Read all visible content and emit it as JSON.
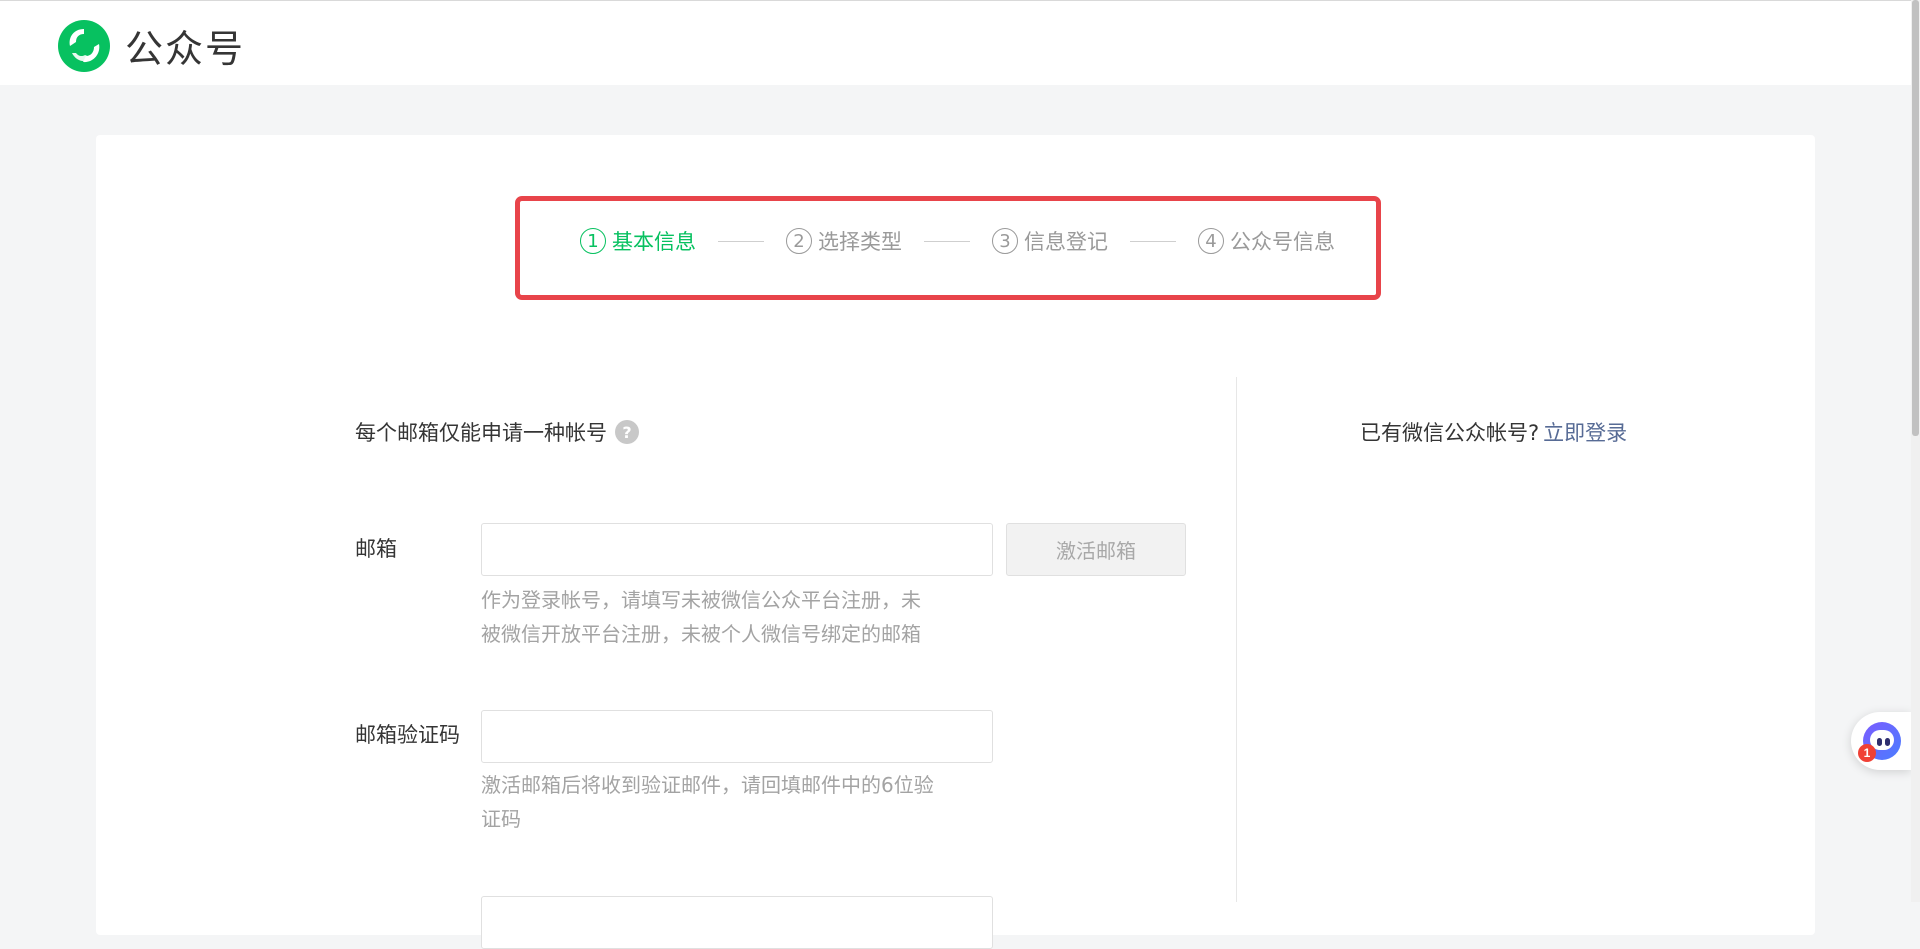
{
  "header": {
    "brand_name": "公众号"
  },
  "stepper": {
    "steps": [
      {
        "num": "1",
        "label": "基本信息",
        "active": true
      },
      {
        "num": "2",
        "label": "选择类型",
        "active": false
      },
      {
        "num": "3",
        "label": "信息登记",
        "active": false
      },
      {
        "num": "4",
        "label": "公众号信息",
        "active": false
      }
    ]
  },
  "form": {
    "notice": "每个邮箱仅能申请一种帐号",
    "email": {
      "label": "邮箱",
      "value": "",
      "placeholder": "",
      "button": "激活邮箱",
      "hint_line1": "作为登录帐号，请填写未被微信公众平台注册，未",
      "hint_line2": "被微信开放平台注册，未被个人微信号绑定的邮箱"
    },
    "code": {
      "label": "邮箱验证码",
      "value": "",
      "placeholder": "",
      "hint_line1": "激活邮箱后将收到验证邮件，请回填邮件中的6位验",
      "hint_line2": "证码"
    }
  },
  "sidebar": {
    "prompt": "已有微信公众帐号?",
    "login_link": "立即登录"
  },
  "assistant": {
    "badge_count": "1"
  },
  "colors": {
    "accent": "#07c160",
    "highlight": "#e8444a",
    "link": "#576b95"
  }
}
